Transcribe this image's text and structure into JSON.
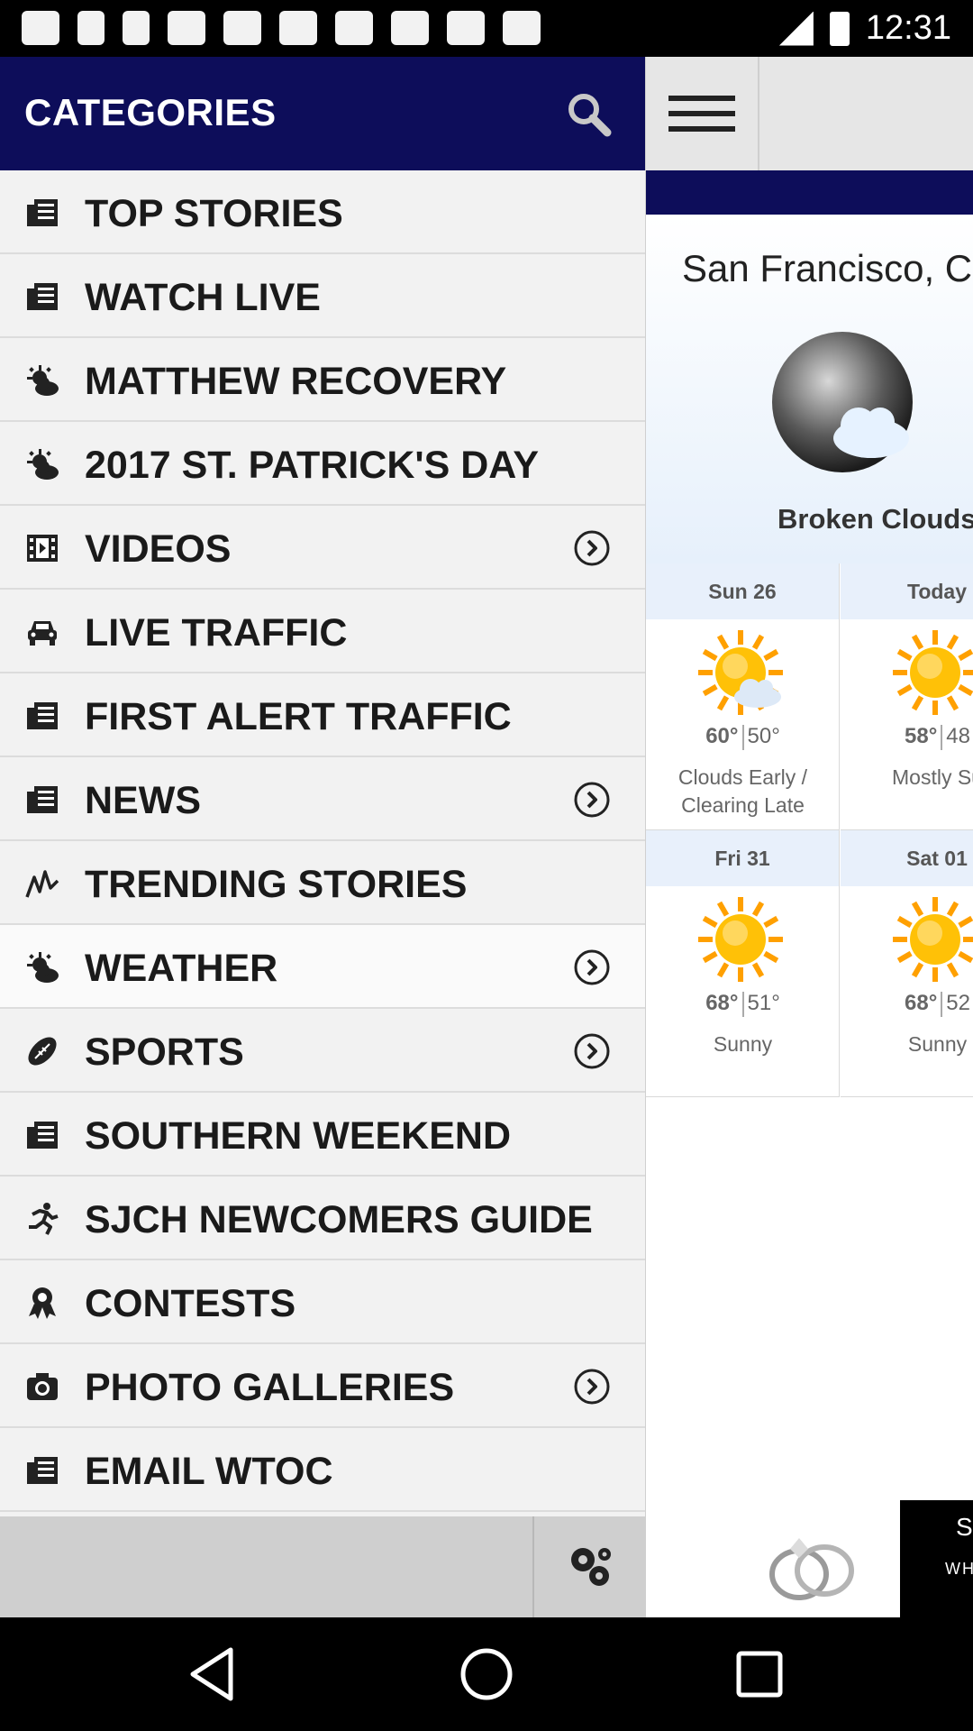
{
  "status_bar": {
    "time": "12:31",
    "icons": [
      "messages-icon",
      "facebook-icon",
      "microscope-icon",
      "app-icon",
      "app-icon",
      "app-icon",
      "app-icon",
      "news-icon",
      "app-icon",
      "app-icon"
    ]
  },
  "drawer": {
    "title": "CATEGORIES",
    "search_icon": "search-icon",
    "items": [
      {
        "label": "TOP STORIES",
        "icon": "newspaper-icon",
        "chevron": false
      },
      {
        "label": "WATCH LIVE",
        "icon": "newspaper-icon",
        "chevron": false
      },
      {
        "label": "MATTHEW RECOVERY",
        "icon": "weather-icon",
        "chevron": false
      },
      {
        "label": "2017 ST. PATRICK'S DAY",
        "icon": "weather-icon",
        "chevron": false
      },
      {
        "label": "VIDEOS",
        "icon": "film-icon",
        "chevron": true
      },
      {
        "label": "LIVE TRAFFIC",
        "icon": "car-icon",
        "chevron": false
      },
      {
        "label": "FIRST ALERT TRAFFIC",
        "icon": "newspaper-icon",
        "chevron": false
      },
      {
        "label": "NEWS",
        "icon": "newspaper-icon",
        "chevron": true
      },
      {
        "label": "TRENDING STORIES",
        "icon": "trending-icon",
        "chevron": false
      },
      {
        "label": "WEATHER",
        "icon": "weather-icon",
        "chevron": true,
        "active": true
      },
      {
        "label": "SPORTS",
        "icon": "football-icon",
        "chevron": true
      },
      {
        "label": "SOUTHERN WEEKEND",
        "icon": "newspaper-icon",
        "chevron": false
      },
      {
        "label": "SJCH NEWCOMERS GUIDE",
        "icon": "runner-icon",
        "chevron": false
      },
      {
        "label": "CONTESTS",
        "icon": "ribbon-icon",
        "chevron": false
      },
      {
        "label": "PHOTO GALLERIES",
        "icon": "camera-icon",
        "chevron": true
      },
      {
        "label": "EMAIL WTOC",
        "icon": "newspaper-icon",
        "chevron": false
      }
    ],
    "settings_icon": "gear-icon"
  },
  "weather": {
    "city": "San Francisco, C",
    "condition": "Broken Clouds",
    "forecast": [
      {
        "day": "Sun 26",
        "hi": "60°",
        "lo": "50°",
        "desc": "Clouds Early / Clearing Late"
      },
      {
        "day": "Today",
        "hi": "58°",
        "lo": "48",
        "desc": "Mostly Su"
      },
      {
        "day": "Fri 31",
        "hi": "68°",
        "lo": "51°",
        "desc": "Sunny"
      },
      {
        "day": "Sat 01",
        "hi": "68°",
        "lo": "52",
        "desc": "Sunny"
      }
    ]
  },
  "ad": {
    "text1": "S",
    "text2": "WHO"
  },
  "colors": {
    "navy": "#0d0d5a",
    "sun": "#ffb300"
  }
}
